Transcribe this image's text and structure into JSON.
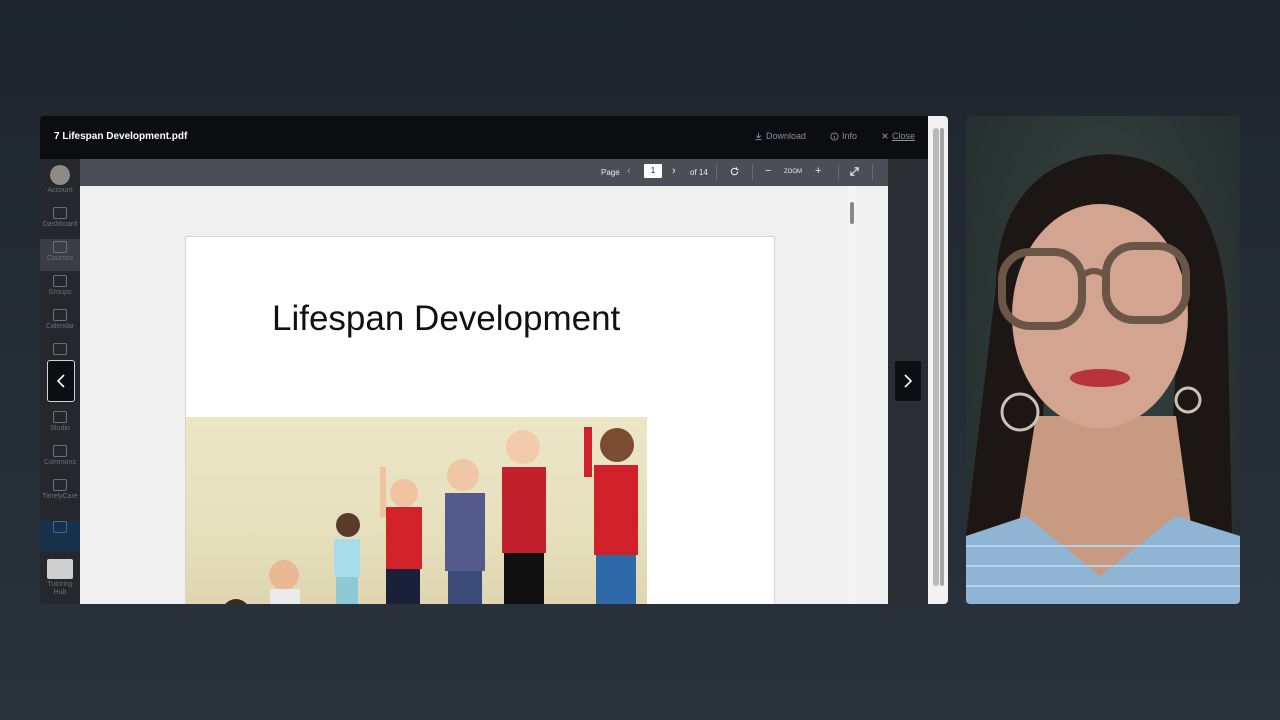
{
  "window": {
    "file_title": "7 Lifespan Development.pdf",
    "download_label": "Download",
    "info_label": "Info",
    "close_label": "Close"
  },
  "sidebar": {
    "items": [
      {
        "label": "Account"
      },
      {
        "label": "Dashboard"
      },
      {
        "label": "Courses"
      },
      {
        "label": "Groups"
      },
      {
        "label": "Calendar"
      },
      {
        "label": "Studio"
      },
      {
        "label": "Commons"
      },
      {
        "label": "TimelyCare"
      },
      {
        "label": "Tutoring Hub"
      }
    ]
  },
  "viewer": {
    "page_label": "Page",
    "current_page": "1",
    "total_pages": "of 14",
    "zoom_label": "ZOOM"
  },
  "document": {
    "slide_title": "Lifespan Development"
  },
  "colors": {
    "titlebar": "#0b0d10",
    "toolbar": "#4a4e55",
    "sidebar": "#24282d",
    "background": "#1e252d"
  }
}
